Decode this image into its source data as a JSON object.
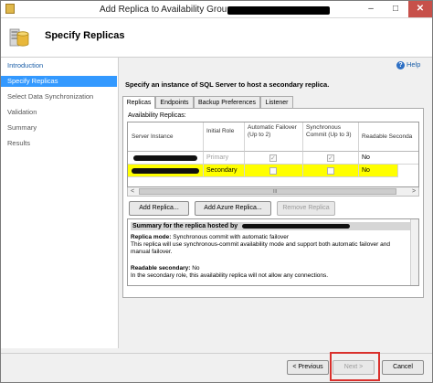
{
  "window": {
    "title": "Add Replica to Availability Group:",
    "minimize_glyph": "–",
    "maximize_glyph": "□",
    "close_glyph": "✕"
  },
  "header": {
    "title": "Specify Replicas"
  },
  "nav": {
    "items": [
      {
        "label": "Introduction",
        "state": "link"
      },
      {
        "label": "Specify Replicas",
        "state": "active"
      },
      {
        "label": "Select Data Synchronization",
        "state": "disabled"
      },
      {
        "label": "Validation",
        "state": "disabled"
      },
      {
        "label": "Summary",
        "state": "disabled"
      },
      {
        "label": "Results",
        "state": "disabled"
      }
    ]
  },
  "help": {
    "label": "Help",
    "icon": "?"
  },
  "main": {
    "instruction": "Specify an instance of SQL Server to host a secondary replica.",
    "tabs": [
      {
        "label": "Replicas",
        "active": true
      },
      {
        "label": "Endpoints",
        "active": false
      },
      {
        "label": "Backup Preferences",
        "active": false
      },
      {
        "label": "Listener",
        "active": false
      }
    ],
    "availability_replicas_label": "Availability Replicas:",
    "table": {
      "headers": {
        "server_instance": "Server Instance",
        "initial_role": "Initial Role",
        "automatic_failover": "Automatic Failover (Up to 2)",
        "synchronous_commit": "Synchronous Commit (Up to 3)",
        "readable_secondary": "Readable Seconda"
      },
      "rows": [
        {
          "initial_role": "Primary",
          "automatic_failover": true,
          "synchronous_commit": true,
          "readable_secondary": "No",
          "highlighted": false
        },
        {
          "initial_role": "Secondary",
          "automatic_failover": false,
          "synchronous_commit": false,
          "readable_secondary": "No",
          "highlighted": true
        }
      ]
    },
    "scroll_left": "<",
    "scroll_right": ">",
    "scroll_grip": "III",
    "buttons": {
      "add_replica": "Add Replica...",
      "add_azure_replica": "Add Azure Replica...",
      "remove_replica": "Remove Replica"
    },
    "summary": {
      "title": "Summary for the replica hosted by",
      "replica_mode_label": "Replica mode:",
      "replica_mode_value": "Synchronous commit with automatic failover",
      "replica_mode_desc_1": "This replica will use synchronous-commit availability mode and support both automatic failover and",
      "replica_mode_desc_2": "manual failover.",
      "readable_secondary_label": "Readable secondary:",
      "readable_secondary_value": "No",
      "readable_secondary_desc": "In the secondary role, this availability replica will not allow any connections."
    }
  },
  "footer": {
    "previous": "< Previous",
    "next": "Next >",
    "cancel": "Cancel"
  },
  "colors": {
    "highlight_yellow": "#ffff00",
    "nav_active": "#3399ff",
    "annotation_red": "#d9302c",
    "close_button": "#c7504a"
  }
}
